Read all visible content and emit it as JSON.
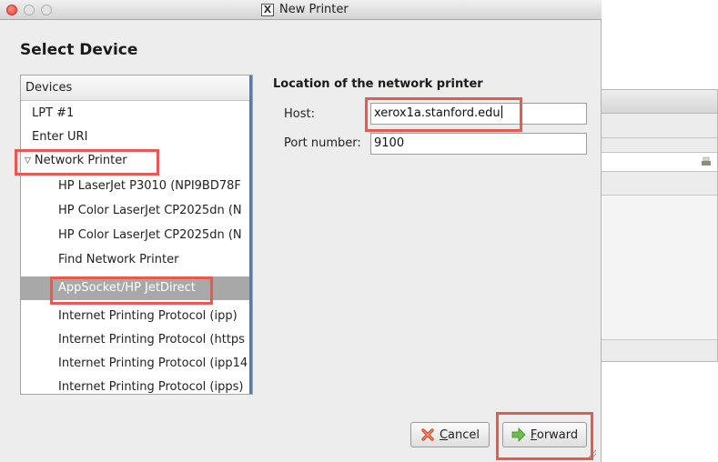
{
  "window": {
    "title": "New Printer"
  },
  "page": {
    "heading": "Select Device"
  },
  "devices": {
    "header": "Devices",
    "items": [
      "LPT #1",
      "Enter URI",
      "Network Printer",
      "HP LaserJet P3010 (NPI9BD78F",
      "HP Color LaserJet CP2025dn (N",
      "HP Color LaserJet CP2025dn (N",
      "Find Network Printer",
      "AppSocket/HP JetDirect",
      "Internet Printing Protocol (ipp)",
      "Internet Printing Protocol (https",
      "Internet Printing Protocol (ipp14",
      "Internet Printing Protocol (ipps)"
    ],
    "selected": "AppSocket/HP JetDirect"
  },
  "location": {
    "title": "Location of the network printer",
    "host_label": "Host:",
    "host_value": "xerox1a.stanford.edu",
    "port_label": "Port number:",
    "port_value": "9100"
  },
  "buttons": {
    "cancel_prefix": "",
    "cancel_mnemonic": "C",
    "cancel_rest": "ancel",
    "forward_mnemonic": "F",
    "forward_rest": "orward"
  },
  "colors": {
    "highlight": "#e85a4f",
    "selection": "#a8a8a8"
  }
}
